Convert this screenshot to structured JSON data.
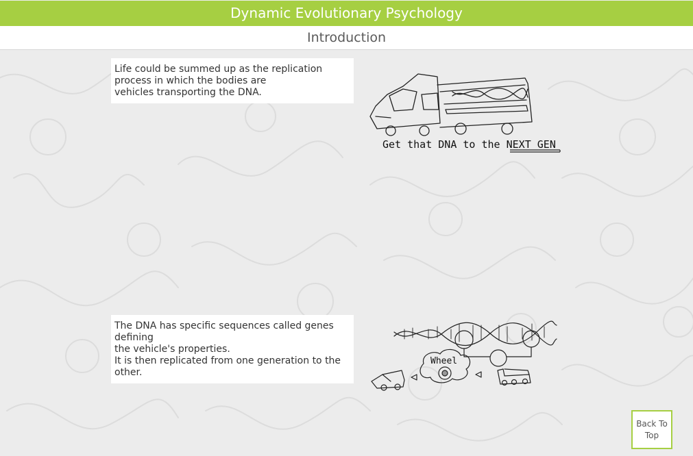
{
  "header": {
    "title": "Dynamic Evolutionary Psychology"
  },
  "subheader": {
    "title": "Introduction"
  },
  "sections": [
    {
      "lines": [
        "Life could be summed up as the replication",
        "process in which the bodies are",
        "vehicles transporting the DNA."
      ],
      "illustration": {
        "caption_prefix": "Get that DNA to the ",
        "caption_emphasis": "NEXT GEN"
      }
    },
    {
      "lines": [
        "The DNA has specific sequences called genes",
        "defining",
        "the vehicle's properties.",
        "It is then replicated from one generation to the",
        "other."
      ],
      "illustration": {
        "bubble_label": "Wheel"
      }
    }
  ],
  "back_to_top": {
    "line1": "Back To",
    "line2": "Top"
  },
  "colors": {
    "accent": "#a6cf42",
    "background": "#ececec",
    "panel": "#ffffff"
  },
  "icons": [
    "truck-dna-sketch",
    "dna-genes-sketch"
  ]
}
